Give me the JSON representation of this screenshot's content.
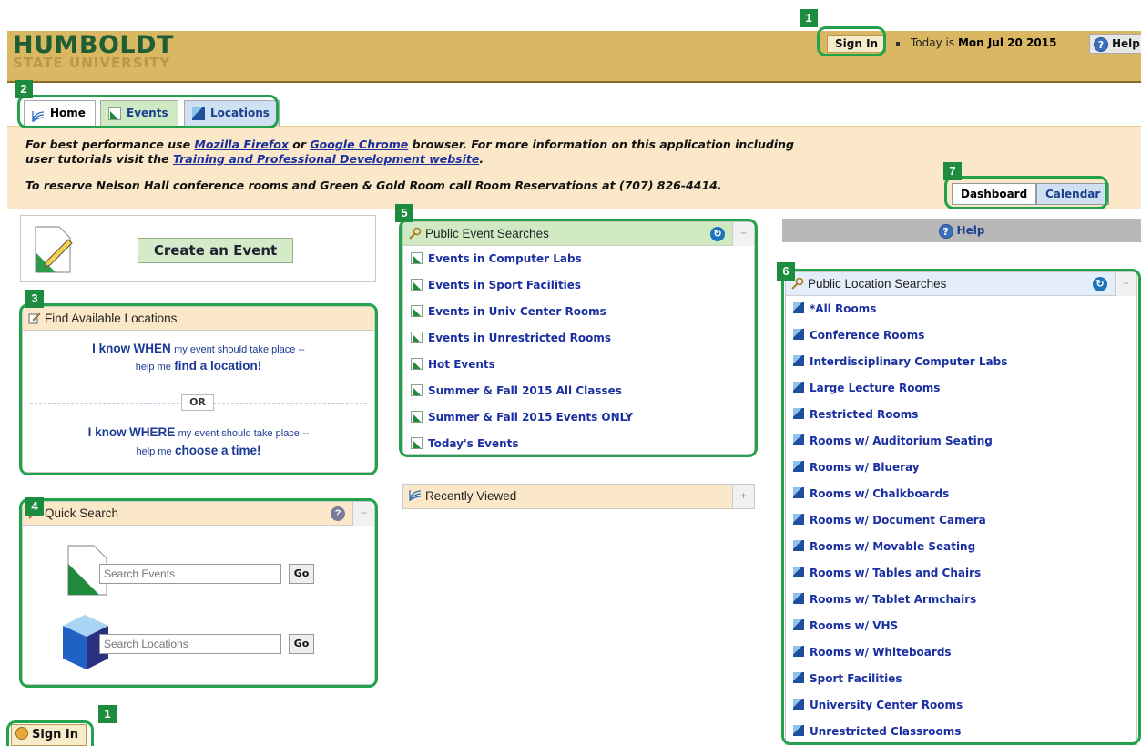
{
  "header": {
    "logo_line1": "HUMBOLDT",
    "logo_line2": "STATE UNIVERSITY",
    "sign_in": "Sign In",
    "today_prefix": "Today is",
    "today_date": "Mon Jul 20 2015",
    "help": "Help"
  },
  "tabs": [
    {
      "label": "Home"
    },
    {
      "label": "Events"
    },
    {
      "label": "Locations"
    }
  ],
  "notice": {
    "line1_a": "For best performance use",
    "firefox": "Mozilla Firefox",
    "or": "or",
    "chrome": "Google Chrome",
    "line1_b": "browser. For more information on this application including",
    "line2_a": "user tutorials visit the",
    "training_link": "Training and Professional Development website",
    "line2_end": ".",
    "line3": "To reserve Nelson Hall conference rooms and Green & Gold Room call Room Reservations at (707) 826-4414."
  },
  "view_tabs": {
    "dashboard": "Dashboard",
    "calendar": "Calendar"
  },
  "create_event": {
    "label": "Create an Event"
  },
  "find_locations": {
    "title": "Find Available Locations",
    "when_a": "I know",
    "when_b": "WHEN",
    "when_c": "my event should take place --",
    "when_d": "help me",
    "when_e": "find a location!",
    "or": "OR",
    "where_a": "I know",
    "where_b": "WHERE",
    "where_c": "my event should take place --",
    "where_d": "help me",
    "where_e": "choose a time!"
  },
  "quick_search": {
    "title": "Quick Search",
    "events_placeholder": "Search Events",
    "locations_placeholder": "Search Locations",
    "go": "Go"
  },
  "public_events": {
    "title": "Public Event Searches",
    "items": [
      "Events in Computer Labs",
      "Events in Sport Facilities",
      "Events in Univ Center Rooms",
      "Events in Unrestricted Rooms",
      "Hot Events",
      "Summer & Fall 2015 All Classes",
      "Summer & Fall 2015 Events ONLY",
      "Today's Events"
    ]
  },
  "recently_viewed": {
    "title": "Recently Viewed"
  },
  "right_help": {
    "label": "Help"
  },
  "public_locations": {
    "title": "Public Location Searches",
    "items": [
      "*All Rooms",
      "Conference Rooms",
      "Interdisciplinary Computer Labs",
      "Large Lecture Rooms",
      "Restricted Rooms",
      "Rooms w/ Auditorium Seating",
      "Rooms w/ Blueray",
      "Rooms w/ Chalkboards",
      "Rooms w/ Document Camera",
      "Rooms w/ Movable Seating",
      "Rooms w/ Tables and Chairs",
      "Rooms w/ Tablet Armchairs",
      "Rooms w/ VHS",
      "Rooms w/ Whiteboards",
      "Sport Facilities",
      "University Center Rooms",
      "Unrestricted Classrooms"
    ]
  },
  "bottom_sign_in": "Sign In",
  "callouts": {
    "c1": "1",
    "c2": "2",
    "c3": "3",
    "c4": "4",
    "c5": "5",
    "c6": "6",
    "c7": "7"
  },
  "colors": {
    "header_bg": "#d9b763",
    "notice_bg": "#fbe8c8",
    "link": "#1a2fa0",
    "callout": "#1e8c3e"
  }
}
